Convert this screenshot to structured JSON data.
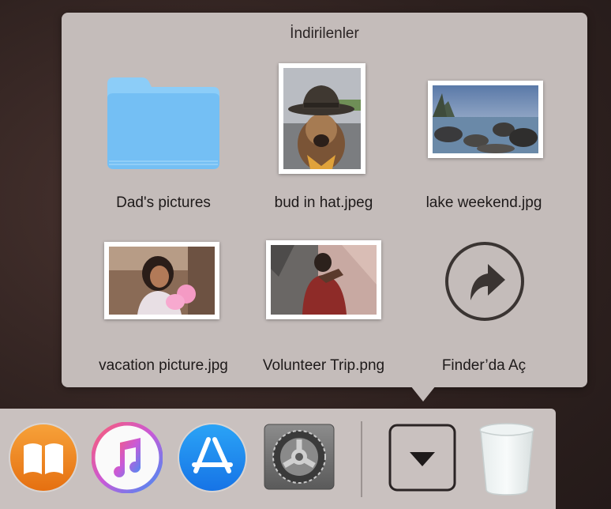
{
  "stack": {
    "title": "İndirilenler",
    "items": [
      {
        "label": "Dad's pictures",
        "kind": "folder",
        "icon": "folder-icon"
      },
      {
        "label": "bud in hat.jpeg",
        "kind": "photo"
      },
      {
        "label": "lake weekend.jpg",
        "kind": "photo"
      },
      {
        "label": "vacation picture.jpg",
        "kind": "photo"
      },
      {
        "label": "Volunteer Trip.png",
        "kind": "photo"
      },
      {
        "label": "Finder’da Aç",
        "kind": "action",
        "icon": "open-in-finder-arrow-icon"
      }
    ]
  },
  "dock": {
    "apps": [
      {
        "icon": "books-icon"
      },
      {
        "icon": "music-icon"
      },
      {
        "icon": "app-store-icon"
      },
      {
        "icon": "system-preferences-gear-icon"
      },
      {
        "icon": "downloads-stack-icon"
      },
      {
        "icon": "trash-icon"
      }
    ]
  },
  "colors": {
    "folder": "#7cc3f5",
    "popover": "#c4bcba",
    "dock": "#c9c1bf",
    "books_orange": "#f08a1c",
    "app_store_blue": "#1e8ef2"
  }
}
